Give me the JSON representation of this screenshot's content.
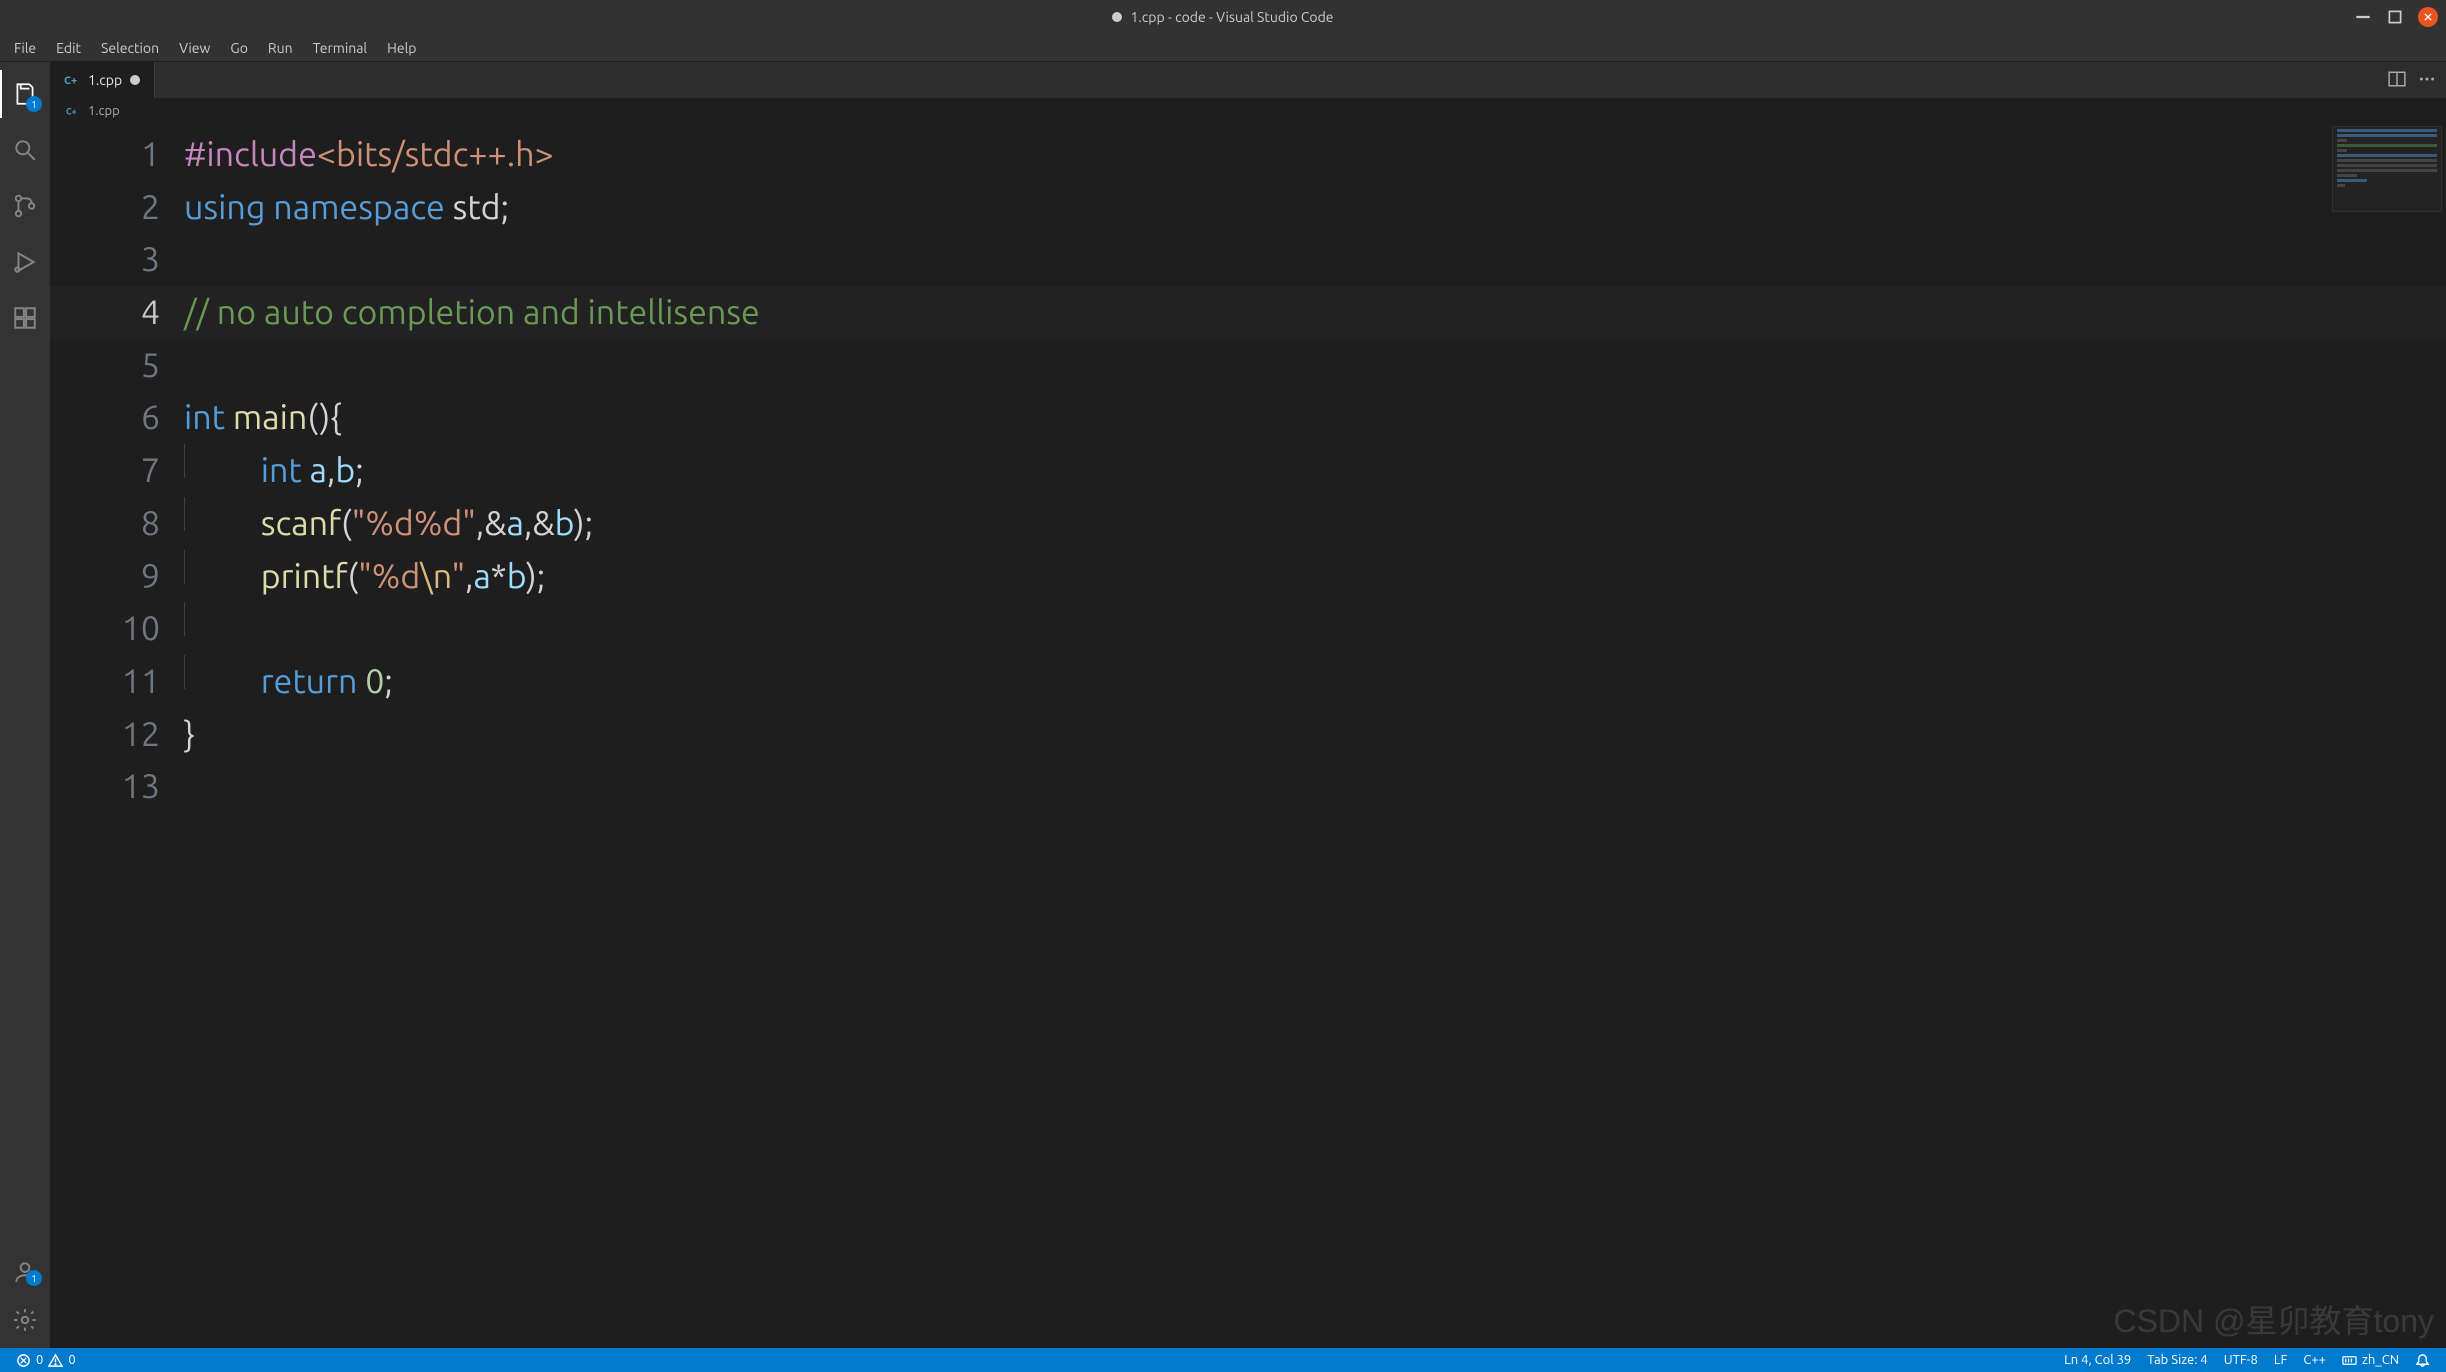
{
  "window": {
    "title": "1.cpp - code - Visual Studio Code",
    "dirty": true
  },
  "menu": {
    "items": [
      "File",
      "Edit",
      "Selection",
      "View",
      "Go",
      "Run",
      "Terminal",
      "Help"
    ]
  },
  "activitybar": {
    "explorer_badge": "1",
    "accounts_badge": "1"
  },
  "tab": {
    "file_name": "1.cpp",
    "language_icon": "C⁺"
  },
  "breadcrumb": {
    "file_name": "1.cpp"
  },
  "code": {
    "lines": [
      {
        "n": 1,
        "tokens": [
          [
            "tk-preproc",
            "#include"
          ],
          [
            "tk-include",
            "<bits/stdc++.h>"
          ]
        ]
      },
      {
        "n": 2,
        "tokens": [
          [
            "tk-keyword",
            "using"
          ],
          [
            "tk-default",
            " "
          ],
          [
            "tk-keyword",
            "namespace"
          ],
          [
            "tk-default",
            " "
          ],
          [
            "tk-default",
            "std"
          ],
          [
            "tk-punct",
            ";"
          ]
        ]
      },
      {
        "n": 3,
        "tokens": []
      },
      {
        "n": 4,
        "current": true,
        "tokens": [
          [
            "tk-comment",
            "// no auto completion and intellisense"
          ]
        ]
      },
      {
        "n": 5,
        "tokens": []
      },
      {
        "n": 6,
        "tokens": [
          [
            "tk-type",
            "int"
          ],
          [
            "tk-default",
            " "
          ],
          [
            "tk-func",
            "main"
          ],
          [
            "tk-punct",
            "(){"
          ]
        ]
      },
      {
        "n": 7,
        "indent": 1,
        "tokens": [
          [
            "tk-type",
            "int"
          ],
          [
            "tk-default",
            " "
          ],
          [
            "tk-var",
            "a"
          ],
          [
            "tk-punct",
            ","
          ],
          [
            "tk-var",
            "b"
          ],
          [
            "tk-punct",
            ";"
          ]
        ]
      },
      {
        "n": 8,
        "indent": 1,
        "tokens": [
          [
            "tk-func",
            "scanf"
          ],
          [
            "tk-punct",
            "("
          ],
          [
            "tk-string",
            "\"%d%d\""
          ],
          [
            "tk-punct",
            ",&"
          ],
          [
            "tk-var",
            "a"
          ],
          [
            "tk-punct",
            ",&"
          ],
          [
            "tk-var",
            "b"
          ],
          [
            "tk-punct",
            ");"
          ]
        ]
      },
      {
        "n": 9,
        "indent": 1,
        "tokens": [
          [
            "tk-func",
            "printf"
          ],
          [
            "tk-punct",
            "("
          ],
          [
            "tk-string",
            "\"%d"
          ],
          [
            "tk-esc",
            "\\n"
          ],
          [
            "tk-string",
            "\""
          ],
          [
            "tk-punct",
            ","
          ],
          [
            "tk-var",
            "a"
          ],
          [
            "tk-punct",
            "*"
          ],
          [
            "tk-var",
            "b"
          ],
          [
            "tk-punct",
            ");"
          ]
        ]
      },
      {
        "n": 10,
        "indent": 1,
        "tokens": []
      },
      {
        "n": 11,
        "indent": 1,
        "tokens": [
          [
            "tk-keyword",
            "return"
          ],
          [
            "tk-default",
            " "
          ],
          [
            "tk-num",
            "0"
          ],
          [
            "tk-punct",
            ";"
          ]
        ]
      },
      {
        "n": 12,
        "tokens": [
          [
            "tk-punct",
            "}"
          ]
        ]
      },
      {
        "n": 13,
        "tokens": []
      }
    ]
  },
  "statusbar": {
    "errors": "0",
    "warnings": "0",
    "position": "Ln 4, Col 39",
    "tab_size": "Tab Size: 4",
    "encoding": "UTF-8",
    "eol": "LF",
    "language": "C++",
    "ime": "zh_CN"
  },
  "watermark": "CSDN @星卯教育tony"
}
